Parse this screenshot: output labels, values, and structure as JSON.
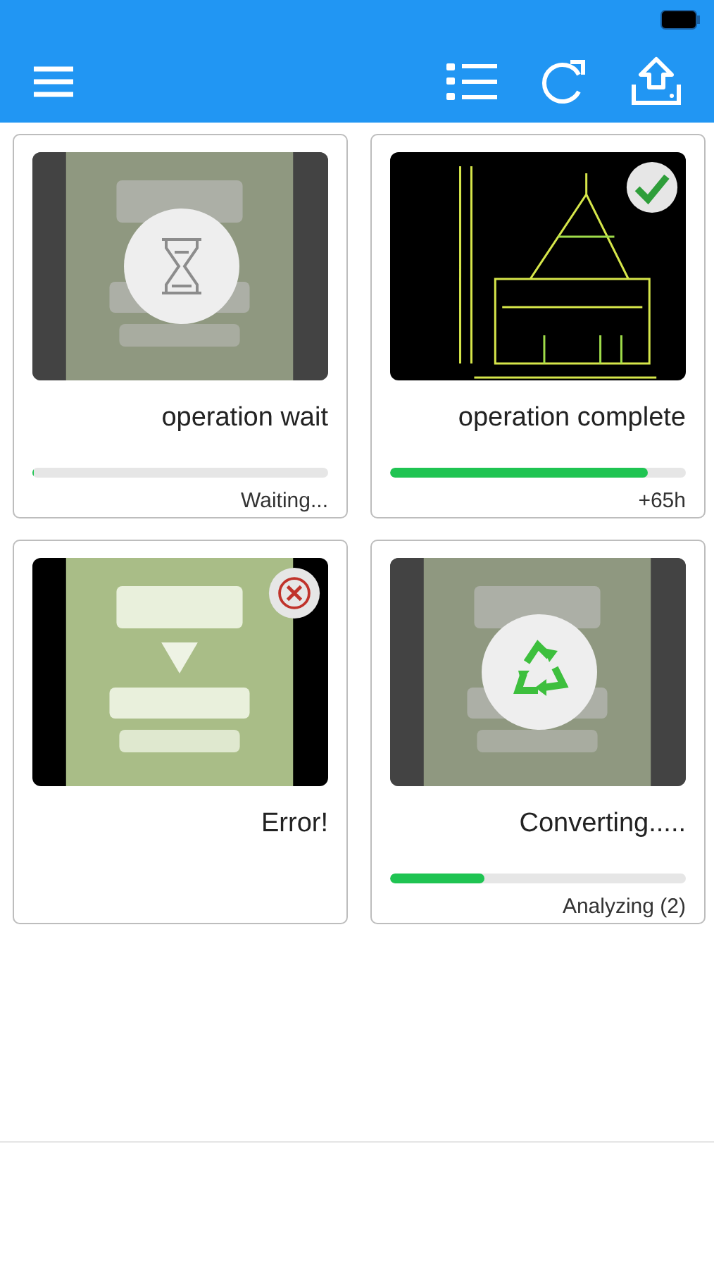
{
  "cards": [
    {
      "kind": "wait",
      "thumbnail": {
        "kind": "banner"
      },
      "dimmed": true,
      "title": "operation wait",
      "progress": {
        "level": 0
      },
      "note": "Waiting..."
    },
    {
      "kind": "complete",
      "thumbnail": {
        "kind": "blueprint"
      },
      "dimmed": false,
      "title": "operation complete",
      "progress": {
        "level": 0.87
      },
      "note": "+65h"
    },
    {
      "kind": "error",
      "thumbnail": {
        "kind": "banner"
      },
      "dimmed": false,
      "title": "Error!"
    },
    {
      "kind": "converting",
      "thumbnail": {
        "kind": "banner"
      },
      "dimmed": true,
      "title": "Converting.....",
      "progress": {
        "level": 0.32
      },
      "note": "Analyzing (2)"
    }
  ]
}
